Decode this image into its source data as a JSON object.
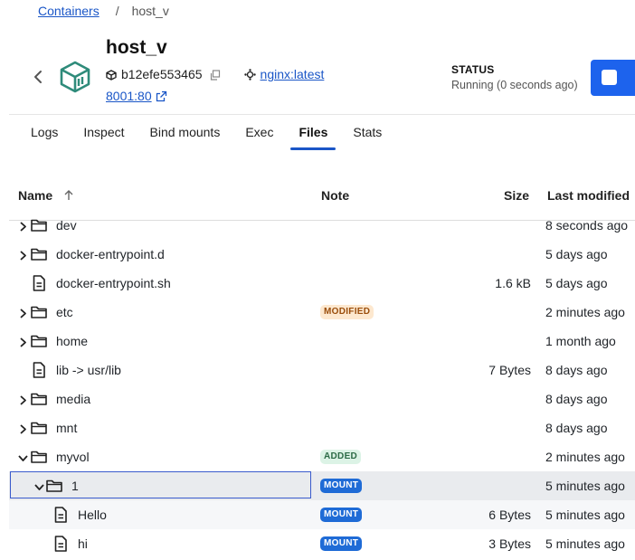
{
  "breadcrumb": {
    "parent": "Containers",
    "separator": "/",
    "current": "host_v"
  },
  "container": {
    "name": "host_v",
    "id": "b12efe553465",
    "image": "nginx:latest",
    "port": "8001:80",
    "status_label": "STATUS",
    "status_value": "Running (0 seconds ago)"
  },
  "tabs": [
    {
      "label": "Logs",
      "active": false
    },
    {
      "label": "Inspect",
      "active": false
    },
    {
      "label": "Bind mounts",
      "active": false
    },
    {
      "label": "Exec",
      "active": false
    },
    {
      "label": "Files",
      "active": true
    },
    {
      "label": "Stats",
      "active": false
    }
  ],
  "table": {
    "headers": {
      "name": "Name",
      "note": "Note",
      "size": "Size",
      "modified": "Last modified"
    },
    "sort_icon": "arrow-up-icon",
    "rows": [
      {
        "name": "dev",
        "type": "folder",
        "depth": 0,
        "expand": "collapsed",
        "note": "",
        "size": "",
        "modified": "8 seconds ago"
      },
      {
        "name": "docker-entrypoint.d",
        "type": "folder",
        "depth": 0,
        "expand": "collapsed",
        "note": "",
        "size": "",
        "modified": "5 days ago"
      },
      {
        "name": "docker-entrypoint.sh",
        "type": "file",
        "depth": 0,
        "expand": "none",
        "note": "",
        "size": "1.6 kB",
        "modified": "5 days ago"
      },
      {
        "name": "etc",
        "type": "folder",
        "depth": 0,
        "expand": "collapsed",
        "note": "MODIFIED",
        "size": "",
        "modified": "2 minutes ago"
      },
      {
        "name": "home",
        "type": "folder",
        "depth": 0,
        "expand": "collapsed",
        "note": "",
        "size": "",
        "modified": "1 month ago"
      },
      {
        "name": "lib -> usr/lib",
        "type": "file",
        "depth": 0,
        "expand": "none",
        "note": "",
        "size": "7 Bytes",
        "modified": "8 days ago"
      },
      {
        "name": "media",
        "type": "folder",
        "depth": 0,
        "expand": "collapsed",
        "note": "",
        "size": "",
        "modified": "8 days ago"
      },
      {
        "name": "mnt",
        "type": "folder",
        "depth": 0,
        "expand": "collapsed",
        "note": "",
        "size": "",
        "modified": "8 days ago"
      },
      {
        "name": "myvol",
        "type": "folder",
        "depth": 0,
        "expand": "expanded",
        "note": "ADDED",
        "size": "",
        "modified": "2 minutes ago"
      },
      {
        "name": "1",
        "type": "folder",
        "depth": 1,
        "expand": "expanded",
        "note": "MOUNT",
        "size": "",
        "modified": "5 minutes ago",
        "selected": true
      },
      {
        "name": "Hello",
        "type": "file",
        "depth": 2,
        "expand": "none",
        "note": "MOUNT",
        "size": "6 Bytes",
        "modified": "5 minutes ago"
      },
      {
        "name": "hi",
        "type": "file",
        "depth": 2,
        "expand": "none",
        "note": "MOUNT",
        "size": "3 Bytes",
        "modified": "5 minutes ago"
      }
    ]
  },
  "colors": {
    "accent": "#1d63ed",
    "link": "#1a56c7",
    "container_icon": "#2e8b7a",
    "mount_badge": "#1f6bd6"
  }
}
